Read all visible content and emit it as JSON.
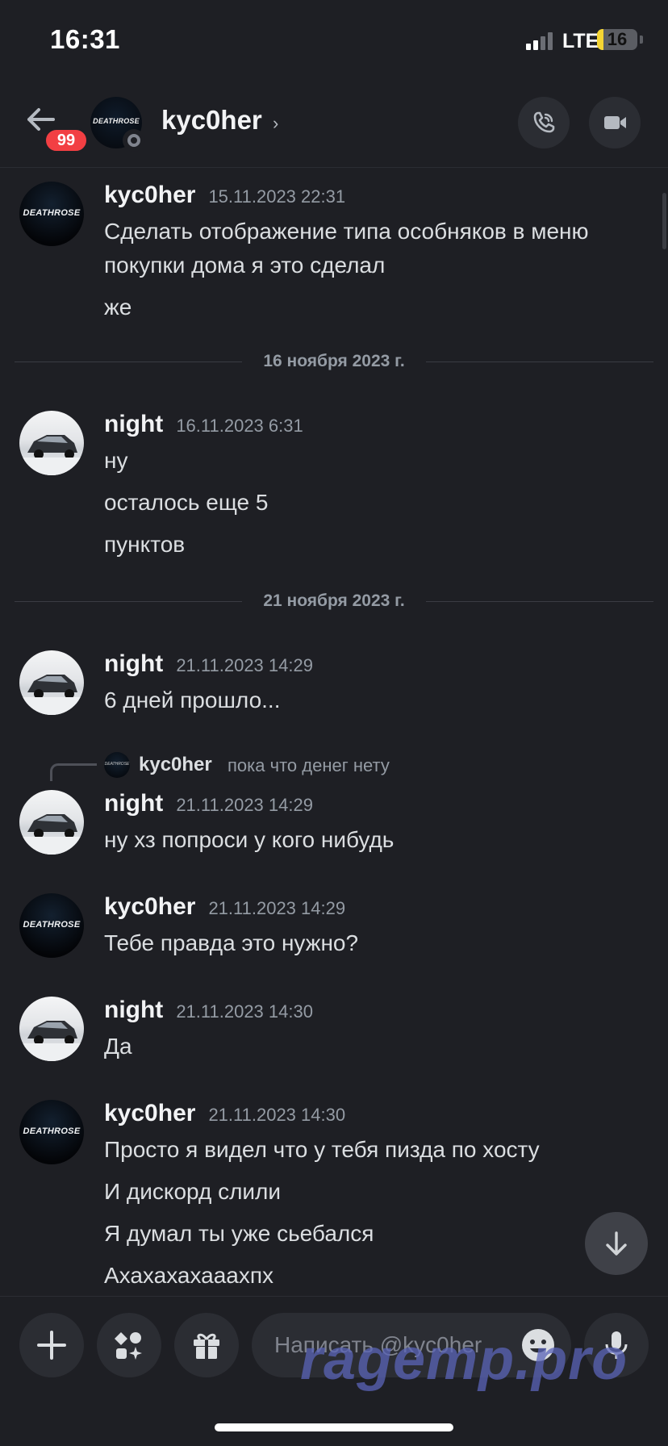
{
  "status_bar": {
    "time": "16:31",
    "network": "LTE",
    "battery": "16",
    "battery_level": 0.16
  },
  "header": {
    "back_badge": "99",
    "avatar_logo": "DEATHROSE",
    "username": "kyc0her",
    "chevron": "›"
  },
  "messages": [
    {
      "author": "kyc0her",
      "avatar": "DEATHROSE",
      "timestamp": "15.11.2023 22:31",
      "lines": [
        "Сделать отображение типа особняков в меню",
        "покупки дома я это сделал",
        "же"
      ]
    },
    {
      "divider": "16 ноября 2023 г."
    },
    {
      "author": "night",
      "avatar": "car",
      "timestamp": "16.11.2023 6:31",
      "lines": [
        "ну",
        "осталось еще 5",
        "пунктов"
      ]
    },
    {
      "divider": "21 ноября 2023 г."
    },
    {
      "author": "night",
      "avatar": "car",
      "timestamp": "21.11.2023 14:29",
      "lines": [
        "6 дней прошло..."
      ]
    },
    {
      "reply_to": {
        "author": "kyc0her",
        "text": "пока что денег нету"
      },
      "author": "night",
      "avatar": "car",
      "timestamp": "21.11.2023 14:29",
      "lines": [
        "ну хз попроси у кого нибудь"
      ]
    },
    {
      "author": "kyc0her",
      "avatar": "DEATHROSE",
      "timestamp": "21.11.2023 14:29",
      "lines": [
        "Тебе правда это нужно?"
      ]
    },
    {
      "author": "night",
      "avatar": "car",
      "timestamp": "21.11.2023 14:30",
      "lines": [
        "Да"
      ]
    },
    {
      "author": "kyc0her",
      "avatar": "DEATHROSE",
      "timestamp": "21.11.2023 14:30",
      "lines": [
        "Просто я видел что у тебя пизда по хосту",
        "И дискорд слили",
        "Я думал ты уже сьебался",
        "Ахахахахааахпх"
      ]
    }
  ],
  "composer": {
    "placeholder": "Написать @kyc0her"
  },
  "watermark": "ragemp.pro",
  "colors": {
    "background": "#1e1f24",
    "badge": "#f23f43",
    "battery": "#f5d533"
  }
}
